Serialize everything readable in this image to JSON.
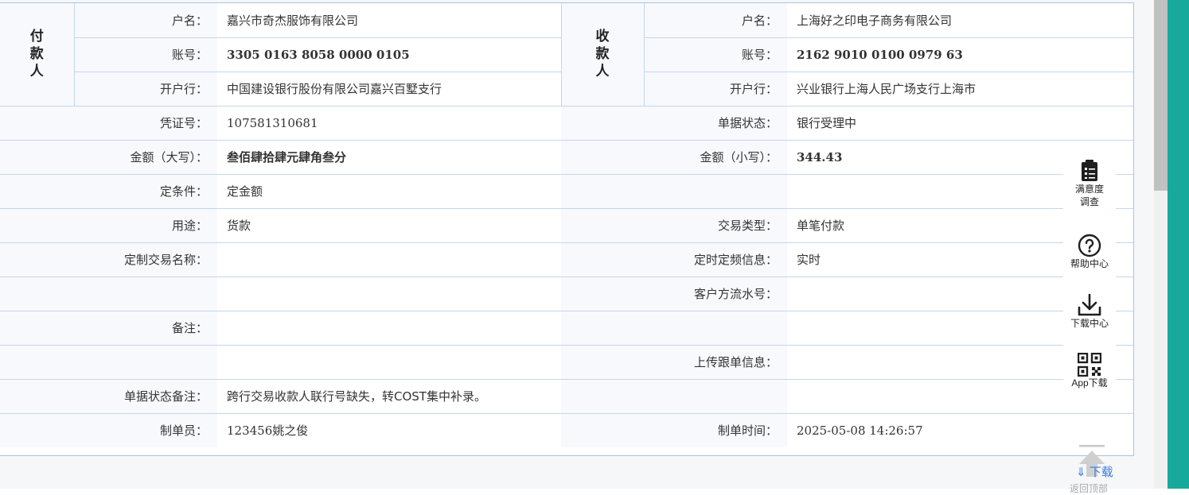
{
  "payer": {
    "heading": "付款人",
    "name_label": "户名：",
    "name": "嘉兴市奇杰服饰有限公司",
    "account_label": "账号：",
    "account": "3305 0163 8058 0000 0105",
    "bank_label": "开户行：",
    "bank": "中国建设银行股份有限公司嘉兴百墅支行"
  },
  "payee": {
    "heading": "收款人",
    "name_label": "户名：",
    "name": "上海好之印电子商务有限公司",
    "account_label": "账号：",
    "account": "2162 9010 0100 0979 63",
    "bank_label": "开户行：",
    "bank": "兴业银行上海人民广场支行上海市"
  },
  "details": {
    "voucher_label": "凭证号：",
    "voucher": "107581310681",
    "doc_status_label": "单据状态：",
    "doc_status": "银行受理中",
    "amount_cn_label": "金额（大写）：",
    "amount_cn": "叁佰肆拾肆元肆角叁分",
    "amount_num_label": "金额（小写）：",
    "amount_num": "344.43",
    "condition_label": "定条件：",
    "condition": "定金额",
    "purpose_label": "用途：",
    "purpose": "货款",
    "tx_type_label": "交易类型：",
    "tx_type": "单笔付款",
    "custom_tx_label": "定制交易名称：",
    "custom_tx": "",
    "schedule_label": "定时定频信息：",
    "schedule": "实时",
    "client_serial_label": "客户方流水号：",
    "client_serial": "",
    "remark_label": "备注：",
    "remark": "",
    "upload_label": "上传跟单信息：",
    "upload": "",
    "status_remark_label": "单据状态备注：",
    "status_remark": "跨行交易收款人联行号缺失，转COST集中补录。",
    "maker_label": "制单员：",
    "maker": "123456姚之俊",
    "made_time_label": "制单时间：",
    "made_time": "2025-05-08 14:26:57"
  },
  "toolbar": {
    "survey": "满意度\n调查",
    "survey_line1": "满意度",
    "survey_line2": "调查",
    "help": "帮助中心",
    "download": "下载中心",
    "app": "App下载"
  },
  "footer": {
    "download_link": "下载",
    "back_top": "返回顶部"
  }
}
